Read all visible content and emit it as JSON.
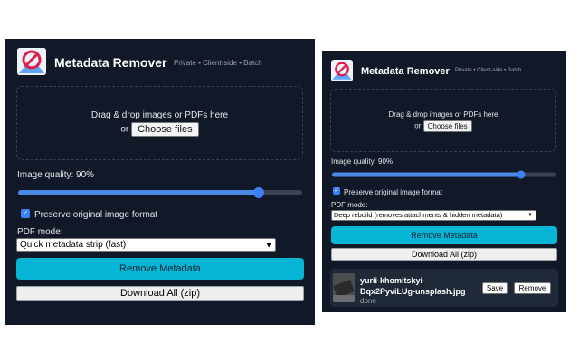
{
  "app": {
    "title": "Metadata Remover",
    "tagline": "Private • Client-side • Batch"
  },
  "dropzone": {
    "text": "Drag & drop images or PDFs here",
    "or": "or",
    "choose_files": "Choose files"
  },
  "quality": {
    "label": "Image quality: 90%",
    "value_percent": 90
  },
  "preserve_format": {
    "label": "Preserve original image format",
    "checked": true
  },
  "pdf_mode_label": "PDF mode:",
  "left_panel": {
    "pdf_mode_selected": "Quick metadata strip (fast)"
  },
  "right_panel": {
    "pdf_mode_selected": "Deep rebuild (removes attachments & hidden metadata)"
  },
  "actions": {
    "remove": "Remove Metadata",
    "download_all": "Download All (zip)"
  },
  "file": {
    "name_line1": "yurii-khomitskyi-",
    "name_line2": "Dqx2PyviLUg-unsplash.jpg",
    "status": "done",
    "save": "Save",
    "remove": "Remove"
  },
  "icons": {
    "logo": "no-image-icon",
    "checkbox": "checkmark-icon",
    "select": "chevron-down-icon"
  },
  "colors": {
    "panel_bg": "#111827",
    "accent": "#06b6d4",
    "slider": "#3b82f6"
  }
}
